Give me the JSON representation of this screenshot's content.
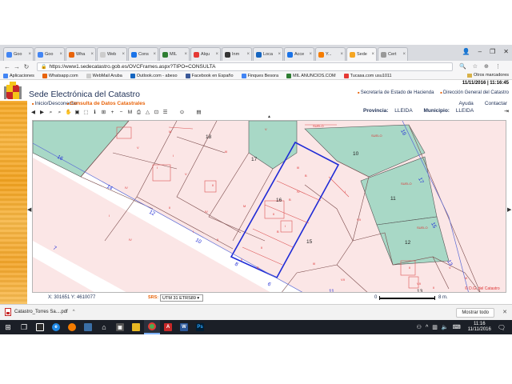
{
  "browser": {
    "tabs": [
      {
        "label": "Goo",
        "color": "#4285f4"
      },
      {
        "label": "Goo",
        "color": "#4285f4"
      },
      {
        "label": "Wha",
        "color": "#e8630a"
      },
      {
        "label": "Web",
        "color": "#cccccc"
      },
      {
        "label": "Cons",
        "color": "#1a73e8"
      },
      {
        "label": "MIL",
        "color": "#2e7d32"
      },
      {
        "label": "Alqu",
        "color": "#e53935"
      },
      {
        "label": "Inm",
        "color": "#333333"
      },
      {
        "label": "Loca",
        "color": "#1565c0"
      },
      {
        "label": "Acce",
        "color": "#1a73e8"
      },
      {
        "label": "Y...",
        "color": "#f57c00"
      },
      {
        "label": "Sede",
        "color": "#f5a623",
        "active": true
      },
      {
        "label": "Cert",
        "color": "#999999"
      }
    ],
    "url": "https://www1.sedecatastro.gob.es/OVCFrames.aspx?TIPO=CONSULTA",
    "bookmarks": [
      {
        "label": "Aplicaciones",
        "color": "#4285f4"
      },
      {
        "label": "Whatsapp.com",
        "color": "#e8630a"
      },
      {
        "label": "WebMail Aruba",
        "color": "#cccccc"
      },
      {
        "label": "Outlook.com - abeso",
        "color": "#1565c0"
      },
      {
        "label": "Facebook en Españo",
        "color": "#3b5998"
      },
      {
        "label": "Finques Besora",
        "color": "#4285f4"
      },
      {
        "label": "MIL ANUNCIOS.COM",
        "color": "#2e7d32"
      },
      {
        "label": "Tucasa.com usu1011",
        "color": "#e53935"
      }
    ],
    "bookmarks_other": "Otros marcadores"
  },
  "site": {
    "date": "11/11/2016 | 11:16:45",
    "title": "Sede Electrónica del Catastro",
    "top_links": [
      "Secretaría de Estado de Hacienda",
      "Dirección General del Catastro"
    ],
    "menu_login": "Inicio/Desconectar",
    "menu_consulta": "Consulta de Datos Catastrales",
    "help": "Ayuda",
    "contact": "Contactar",
    "province_label": "Provincia:",
    "province_value": "LLEIDA",
    "municipality_label": "Municipio:",
    "municipality_value": "LLEIDA"
  },
  "map": {
    "parcel_numbers": [
      "18",
      "17",
      "16",
      "15",
      "10",
      "11",
      "12",
      "13",
      "16",
      "14",
      "12",
      "10",
      "8",
      "6",
      "7",
      "19",
      "17",
      "15",
      "13",
      "11"
    ],
    "watermark": "© D.G. del Catastro",
    "small_labels": [
      "V",
      "V",
      "M",
      "IV",
      "II",
      "I",
      "IV",
      "II",
      "III",
      "III",
      "IV",
      "II",
      "I",
      "II",
      "II",
      "V",
      "VII",
      "III",
      "IV",
      "SUELO",
      "SUELO",
      "SUELO",
      "SUELO",
      "I",
      "II",
      "V",
      "III",
      "M",
      "I",
      "I",
      "II",
      "I",
      "VII",
      "VII",
      "II",
      "B",
      "B",
      "B",
      "B"
    ]
  },
  "status": {
    "coords": "X: 301651 Y: 4610077",
    "srs_label": "SRS:",
    "srs_value": "UTM 31 ETRS89 ▾",
    "scale_start": "0",
    "scale_end": "8 m."
  },
  "downloads": {
    "file": "Catastro_Torres Sa....pdf",
    "show_all": "Mostrar todo"
  },
  "taskbar": {
    "time": "11:16",
    "date": "11/11/2016"
  },
  "colors": {
    "accent": "#e8630a",
    "brand_blue": "#1d2f55",
    "parcel_fill": "#fbe6e6",
    "green_fill": "#a8d8c6",
    "selection": "#1f2bd6"
  }
}
